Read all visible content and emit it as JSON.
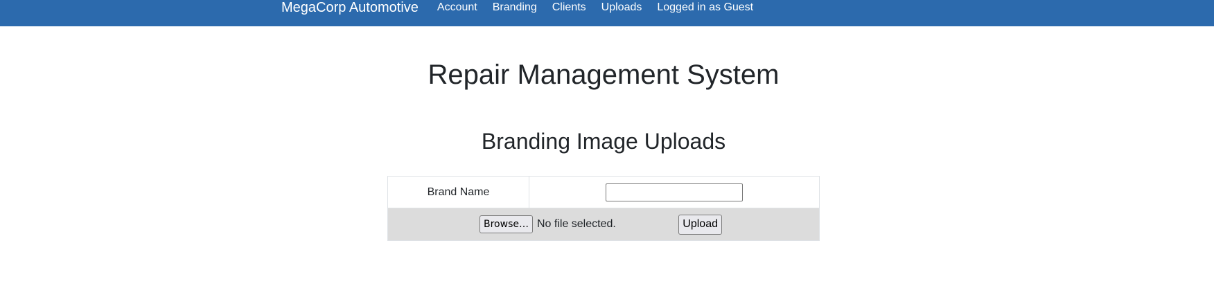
{
  "navbar": {
    "brand": "MegaCorp Automotive",
    "links": [
      "Account",
      "Branding",
      "Clients",
      "Uploads",
      "Logged in as Guest"
    ],
    "background_color": "#2c6aad"
  },
  "main": {
    "title": "Repair Management System",
    "section_title": "Branding Image Uploads",
    "form": {
      "brand_name_label": "Brand Name",
      "brand_name_value": "",
      "browse_label": "Browse…",
      "file_status": "No file selected.",
      "upload_label": "Upload"
    }
  }
}
